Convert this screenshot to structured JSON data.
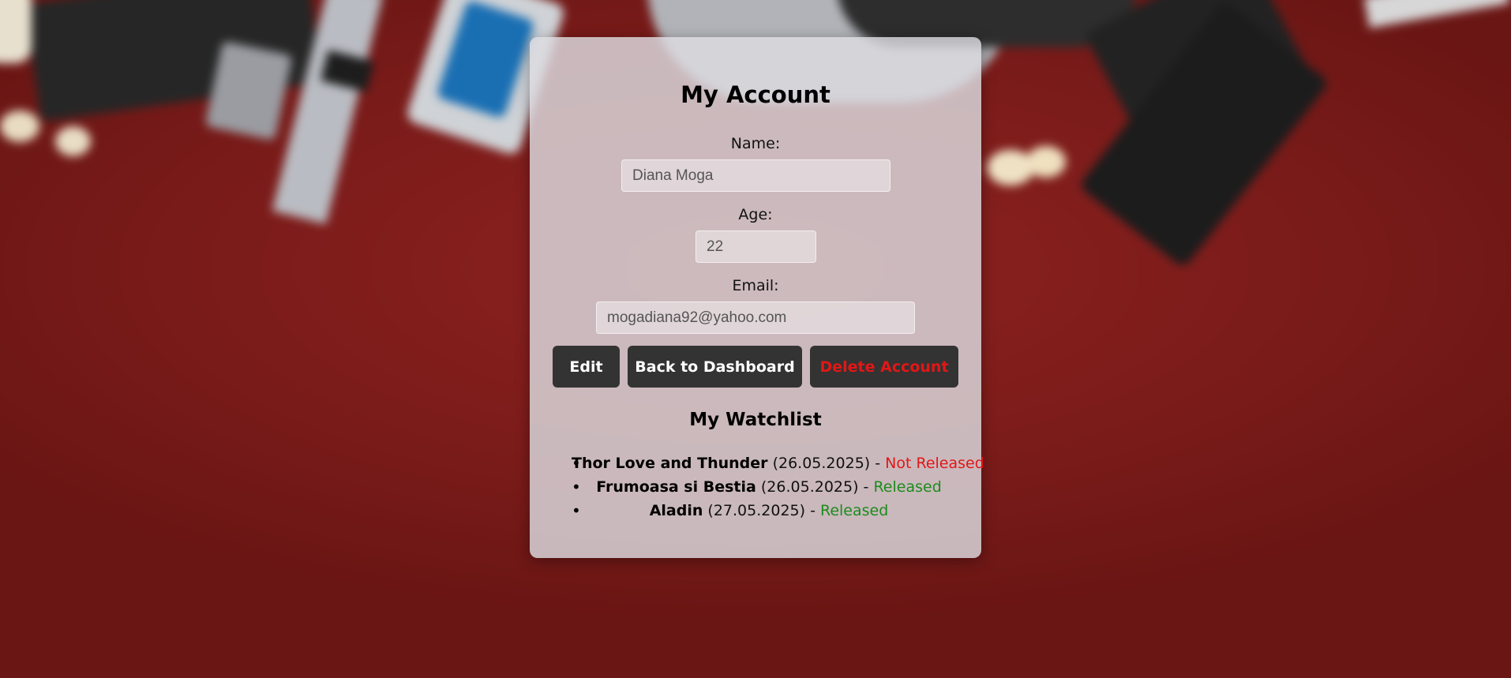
{
  "page": {
    "title": "My Account"
  },
  "fields": {
    "name_label": "Name:",
    "name_value": "Diana Moga",
    "age_label": "Age:",
    "age_value": "22",
    "email_label": "Email:",
    "email_value": "mogadiana92@yahoo.com"
  },
  "actions": {
    "edit_label": "Edit",
    "dashboard_label": "Back to Dashboard",
    "delete_label": "Delete Account"
  },
  "watchlist": {
    "heading": "My Watchlist",
    "items": [
      {
        "title": "Thor Love and Thunder",
        "date": "(26.05.2025)",
        "separator": " - ",
        "status": "Not Released",
        "status_color": "#e31616"
      },
      {
        "title": "Frumoasa si Bestia",
        "date": "(26.05.2025)",
        "separator": " - ",
        "status": "Released",
        "status_color": "#1b8c1b"
      },
      {
        "title": "Aladin",
        "date": "(27.05.2025)",
        "separator": " - ",
        "status": "Released",
        "status_color": "#1b8c1b"
      }
    ]
  },
  "colors": {
    "background": "#7d1d1b",
    "button": "#333333",
    "danger": "#e31616",
    "released": "#1b8c1b"
  }
}
